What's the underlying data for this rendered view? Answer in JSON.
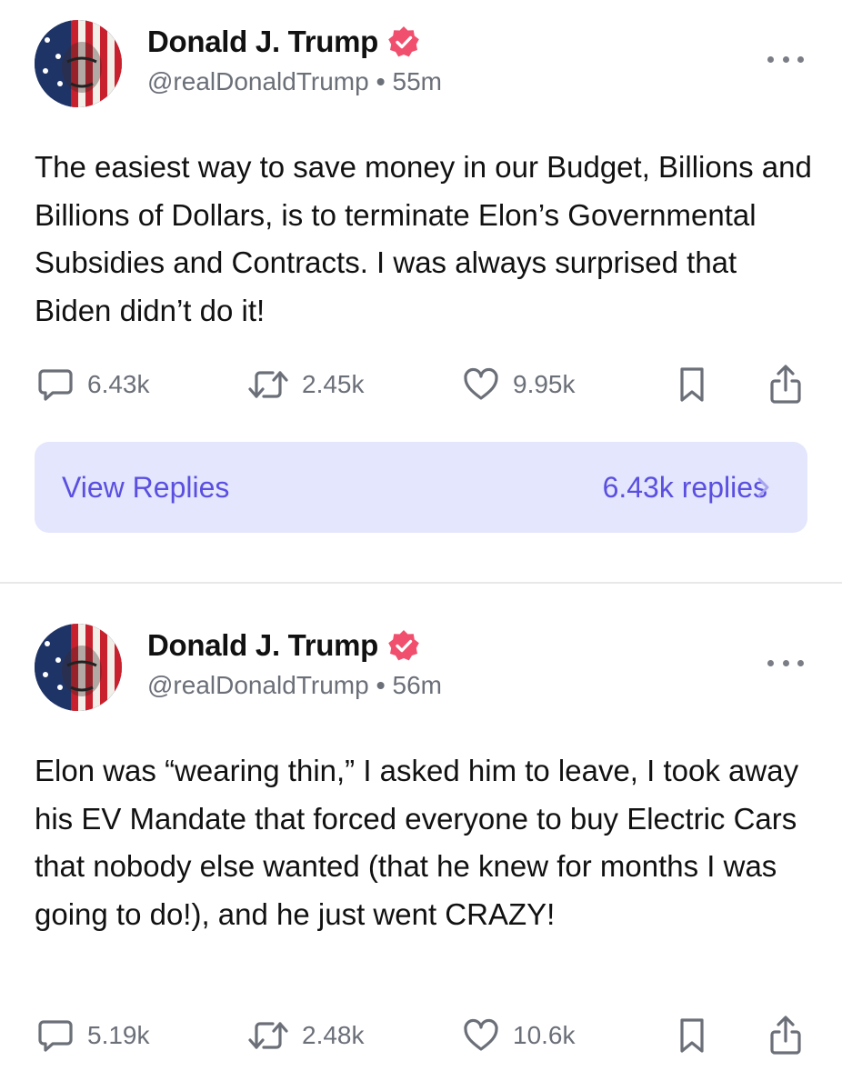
{
  "posts": [
    {
      "author_name": "Donald J. Trump",
      "handle": "@realDonaldTrump",
      "separator": "•",
      "time": "55m",
      "text": "The easiest way to save money in our Budget, Billions and Billions of Dollars, is to terminate Elon’s Governmental Subsidies and Contracts. I was always surprised that Biden didn’t do it!",
      "replies_count": "6.43k",
      "reposts_count": "2.45k",
      "likes_count": "9.95k",
      "view_replies_label": "View Replies",
      "replies_summary": "6.43k replies"
    },
    {
      "author_name": "Donald J. Trump",
      "handle": "@realDonaldTrump",
      "separator": "•",
      "time": "56m",
      "text": "Elon was “wearing thin,” I asked him to leave, I took away his EV Mandate that forced everyone to buy Electric Cars that nobody else wanted (that he knew for months I was going to do!), and he just went CRAZY!",
      "replies_count": "5.19k",
      "reposts_count": "2.48k",
      "likes_count": "10.6k"
    }
  ],
  "icons": {
    "verified": "verified-badge-icon",
    "more": "more-horizontal-icon",
    "reply": "comment-bubble-icon",
    "repost": "repost-icon",
    "like": "heart-icon",
    "bookmark": "bookmark-icon",
    "share": "share-icon",
    "chevron": "chevron-right-icon"
  },
  "colors": {
    "accent": "#5a4fe0",
    "accent_bg": "#e3e6fc",
    "verified": "#f0506e",
    "muted_text": "#6b6f78",
    "icon_gray": "#6b6f78"
  }
}
